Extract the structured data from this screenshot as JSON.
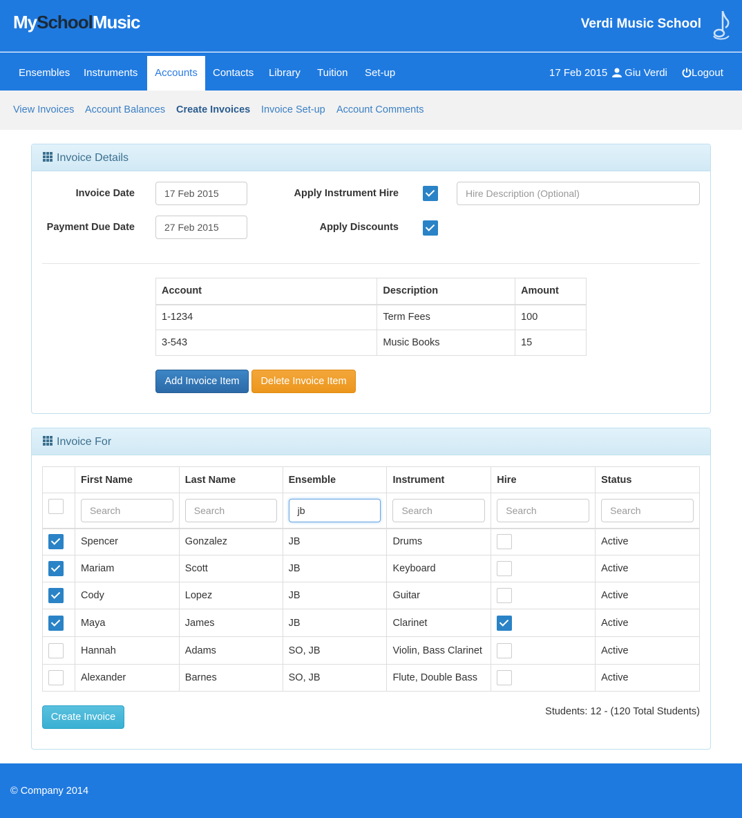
{
  "header": {
    "logo_my": "My",
    "logo_school": "School",
    "logo_music": "Music",
    "school_name": "Verdi Music School"
  },
  "nav": {
    "items": [
      {
        "label": "Ensembles",
        "active": false
      },
      {
        "label": "Instruments",
        "active": false
      },
      {
        "label": "Accounts",
        "active": true
      },
      {
        "label": "Contacts",
        "active": false
      },
      {
        "label": "Library",
        "active": false
      },
      {
        "label": "Tuition",
        "active": false
      },
      {
        "label": "Set-up",
        "active": false
      }
    ],
    "date": "17 Feb 2015",
    "user": "Giu Verdi",
    "logout": "Logout"
  },
  "subnav": {
    "items": [
      {
        "label": "View Invoices",
        "active": false
      },
      {
        "label": "Account Balances",
        "active": false
      },
      {
        "label": "Create Invoices",
        "active": true
      },
      {
        "label": "Invoice Set-up",
        "active": false
      },
      {
        "label": "Account Comments",
        "active": false
      }
    ]
  },
  "invoice_details": {
    "title": "Invoice Details",
    "invoice_date_label": "Invoice Date",
    "invoice_date": "17 Feb 2015",
    "payment_due_label": "Payment Due Date",
    "payment_due": "27 Feb 2015",
    "apply_hire_label": "Apply Instrument Hire",
    "apply_hire": true,
    "hire_desc_placeholder": "Hire Description (Optional)",
    "apply_discounts_label": "Apply Discounts",
    "apply_discounts": true,
    "items_columns": [
      "Account",
      "Description",
      "Amount"
    ],
    "items": [
      [
        "1-1234",
        "Term Fees",
        "100"
      ],
      [
        "3-543",
        "Music Books",
        "15"
      ]
    ],
    "add_button": "Add Invoice Item",
    "delete_button": "Delete Invoice Item"
  },
  "invoice_for": {
    "title": "Invoice For",
    "columns": [
      "First Name",
      "Last Name",
      "Ensemble",
      "Instrument",
      "Hire",
      "Status"
    ],
    "search_placeholder": "Search",
    "filters": {
      "first": "",
      "last": "",
      "ensemble": "jb",
      "instrument": "",
      "hire": "",
      "status": ""
    },
    "rows": [
      {
        "selected": true,
        "first": "Spencer",
        "last": "Gonzalez",
        "ensemble": "JB",
        "instrument": "Drums",
        "hire": false,
        "status": "Active"
      },
      {
        "selected": true,
        "first": "Mariam",
        "last": "Scott",
        "ensemble": "JB",
        "instrument": "Keyboard",
        "hire": false,
        "status": "Active"
      },
      {
        "selected": true,
        "first": "Cody",
        "last": "Lopez",
        "ensemble": "JB",
        "instrument": "Guitar",
        "hire": false,
        "status": "Active"
      },
      {
        "selected": true,
        "first": "Maya",
        "last": "James",
        "ensemble": "JB",
        "instrument": "Clarinet",
        "hire": true,
        "status": "Active"
      },
      {
        "selected": false,
        "first": "Hannah",
        "last": "Adams",
        "ensemble": "SO, JB",
        "instrument": "Violin, Bass Clarinet",
        "hire": false,
        "status": "Active"
      },
      {
        "selected": false,
        "first": "Alexander",
        "last": "Barnes",
        "ensemble": "SO, JB",
        "instrument": "Flute, Double Bass",
        "hire": false,
        "status": "Active"
      }
    ],
    "create_button": "Create Invoice",
    "students_count": "Students: 12 - (120 Total Students)"
  },
  "footer": {
    "text": "© Company 2014"
  },
  "colors": {
    "brand": "#1f7ae0",
    "checkbox": "#2a83c6",
    "orange": "#ec961c",
    "cyan": "#39b0d3"
  }
}
